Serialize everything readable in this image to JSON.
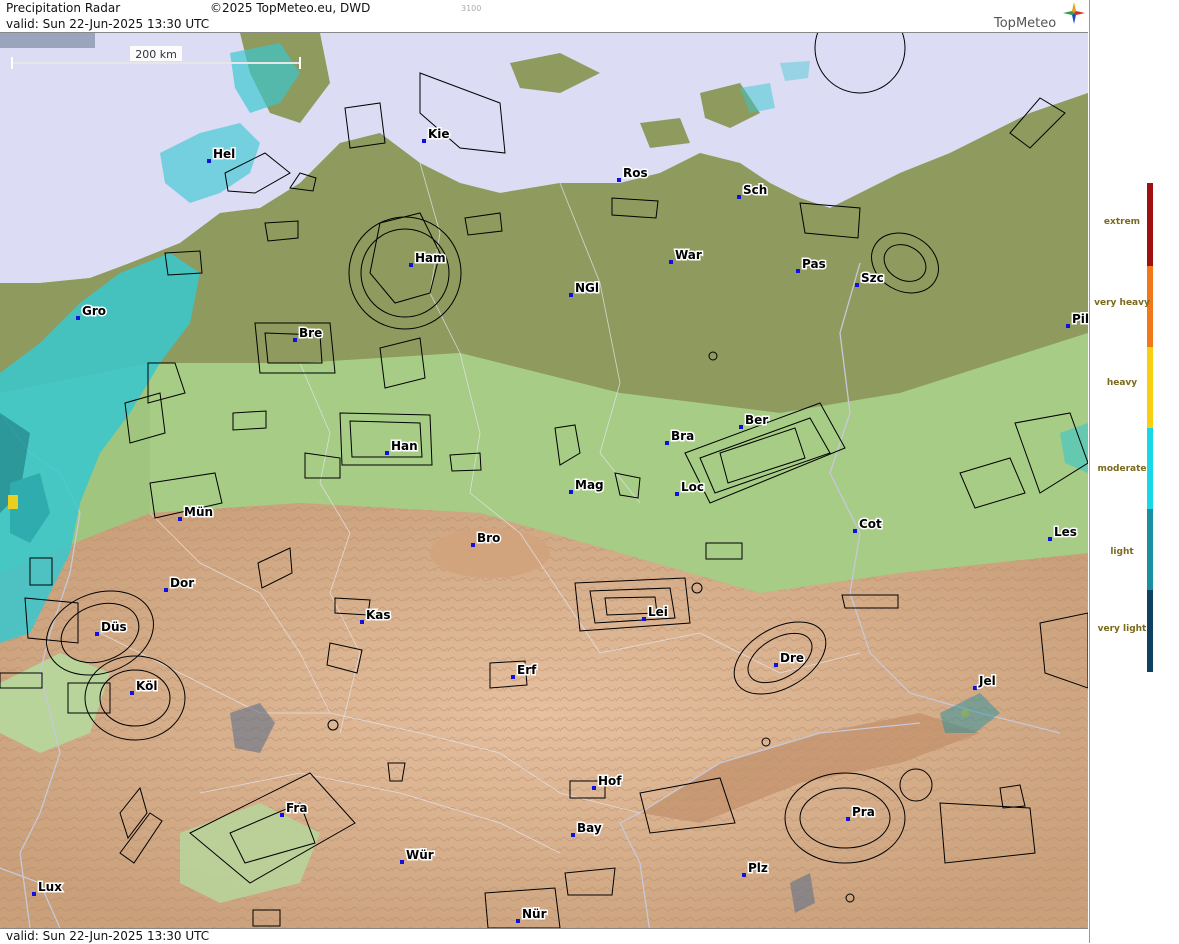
{
  "header": {
    "product": "Precipitation Radar",
    "copyright": "©2025 TopMeteo.eu, DWD",
    "code": "3100",
    "valid": "valid:  Sun  22-Jun-2025 13:30 UTC",
    "logo_text": "TopMeteo",
    "logo_icon": "compass-star-icon"
  },
  "footer": {
    "valid": "valid:  Sun  22-Jun-2025 13:30 UTC"
  },
  "scale": {
    "label": "200 km"
  },
  "legend": {
    "levels": [
      {
        "label": "extrem",
        "color": "#a01010"
      },
      {
        "label": "very heavy",
        "color": "#f07818"
      },
      {
        "label": "heavy",
        "color": "#f8d010"
      },
      {
        "label": "moderate",
        "color": "#18d8e8"
      },
      {
        "label": "light",
        "color": "#1890a0"
      },
      {
        "label": "very light",
        "color": "#104060"
      }
    ]
  },
  "colors": {
    "sea": "#dcdcf4",
    "lowland": "#9bc47a",
    "highland": "#d4a882",
    "radar": "#38c8d0",
    "city_dot": "#1010e0"
  },
  "cities": [
    {
      "name": "Hel"
    },
    {
      "name": "Kie"
    },
    {
      "name": "Ros"
    },
    {
      "name": "Sch"
    },
    {
      "name": "Ham"
    },
    {
      "name": "War"
    },
    {
      "name": "Pas"
    },
    {
      "name": "Szc"
    },
    {
      "name": "NGl"
    },
    {
      "name": "Gro"
    },
    {
      "name": "Bre"
    },
    {
      "name": "Pil"
    },
    {
      "name": "Ber"
    },
    {
      "name": "Bra"
    },
    {
      "name": "Han"
    },
    {
      "name": "Mag"
    },
    {
      "name": "Loc"
    },
    {
      "name": "Mün"
    },
    {
      "name": "Cot"
    },
    {
      "name": "Les"
    },
    {
      "name": "Bro"
    },
    {
      "name": "Dor"
    },
    {
      "name": "Lei"
    },
    {
      "name": "Kas"
    },
    {
      "name": "Düs"
    },
    {
      "name": "Dre"
    },
    {
      "name": "Erf"
    },
    {
      "name": "Köl"
    },
    {
      "name": "Jel"
    },
    {
      "name": "Hof"
    },
    {
      "name": "Fra"
    },
    {
      "name": "Pra"
    },
    {
      "name": "Bay"
    },
    {
      "name": "Wür"
    },
    {
      "name": "Plz"
    },
    {
      "name": "Lux"
    },
    {
      "name": "Nür"
    }
  ]
}
